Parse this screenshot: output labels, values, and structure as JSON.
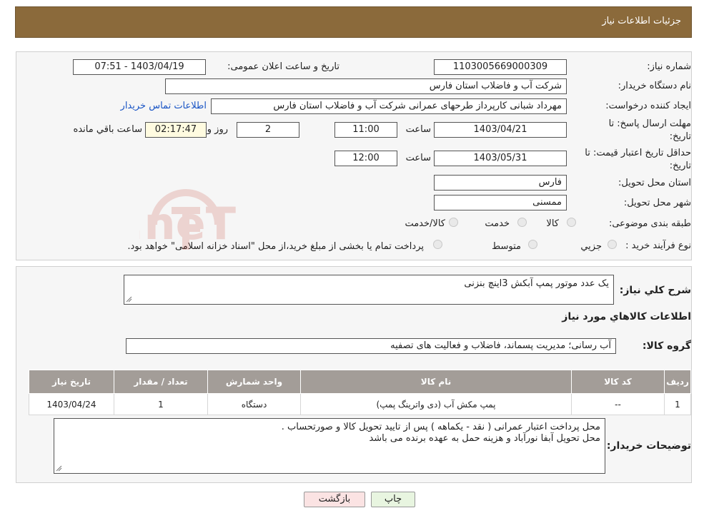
{
  "header": {
    "title": "جزئیات اطلاعات نیاز"
  },
  "form": {
    "need_number_label": "شماره نیاز:",
    "need_number": "1103005669000309",
    "announce_label": "تاریخ و ساعت اعلان عمومی:",
    "announce_value": "1403/04/19 - 07:51",
    "buyer_org_label": "نام دستگاه خریدار:",
    "buyer_org": "شرکت آب و فاضلاب استان فارس",
    "requester_label": "ایجاد کننده درخواست:",
    "requester": "مهرداد شبانی کارپرداز طرحهای عمرانی  شرکت آب و فاضلاب استان فارس",
    "contact_link": "اطلاعات تماس خریدار",
    "deadline_label_1": "مهلت ارسال پاسخ: تا",
    "deadline_label_2": "تاریخ:",
    "deadline_date": "1403/04/21",
    "time_label": "ساعت",
    "deadline_time": "11:00",
    "days_value": "2",
    "days_label": "روز و",
    "remaining_time": "02:17:47",
    "remaining_label": "ساعت باقي مانده",
    "validity_label_1": "حداقل تاريخ اعتبار قيمت: تا",
    "validity_label_2": "تاريخ:",
    "validity_date": "1403/05/31",
    "validity_time": "12:00",
    "province_label": "استان محل تحویل:",
    "province": "فارس",
    "city_label": "شهر محل تحویل:",
    "city": "ممسنی",
    "category_label": "طبقه بندی موضوعی:",
    "category_options": [
      "کالا",
      "خدمت",
      "کالا/خدمت"
    ],
    "process_label": "نوع فرآیند خرید :",
    "process_options": [
      "جزيي",
      "متوسط"
    ],
    "process_note": "پرداخت تمام یا بخشی از مبلغ خرید،از محل \"اسناد خزانه اسلامی\" خواهد بود."
  },
  "description": {
    "label": "شرح کلي نياز:",
    "value": "یک عدد موتور پمپ آبکش 3اینچ بنزنی"
  },
  "items_section": {
    "title": "اطلاعات کالاهاي مورد نياز",
    "group_label": "گروه کالا:",
    "group_value": "آب رسانی؛ مدیریت پسماند، فاضلاب و فعالیت های تصفیه"
  },
  "table": {
    "headers": [
      "رديف",
      "کد کالا",
      "نام کالا",
      "واحد شمارش",
      "تعداد / مقدار",
      "تاريخ نياز"
    ],
    "rows": [
      [
        "1",
        "--",
        "پمپ مکش آب (دی واترینگ پمپ)",
        "دستگاه",
        "1",
        "1403/04/24"
      ]
    ]
  },
  "buyer_notes": {
    "label": "توضيحات خريدار:",
    "line1": "محل پرداخت اعتبار عمرانی ( نقد - یکماهه ) پس از تایید تحویل کالا و صورتحساب .",
    "line2": "محل تحویل  آبفا نورآباد و هزینه حمل به عهده برنده می باشد"
  },
  "buttons": {
    "print": "چاپ",
    "back": "بازگشت"
  },
  "watermark": "AriaTender.neT"
}
